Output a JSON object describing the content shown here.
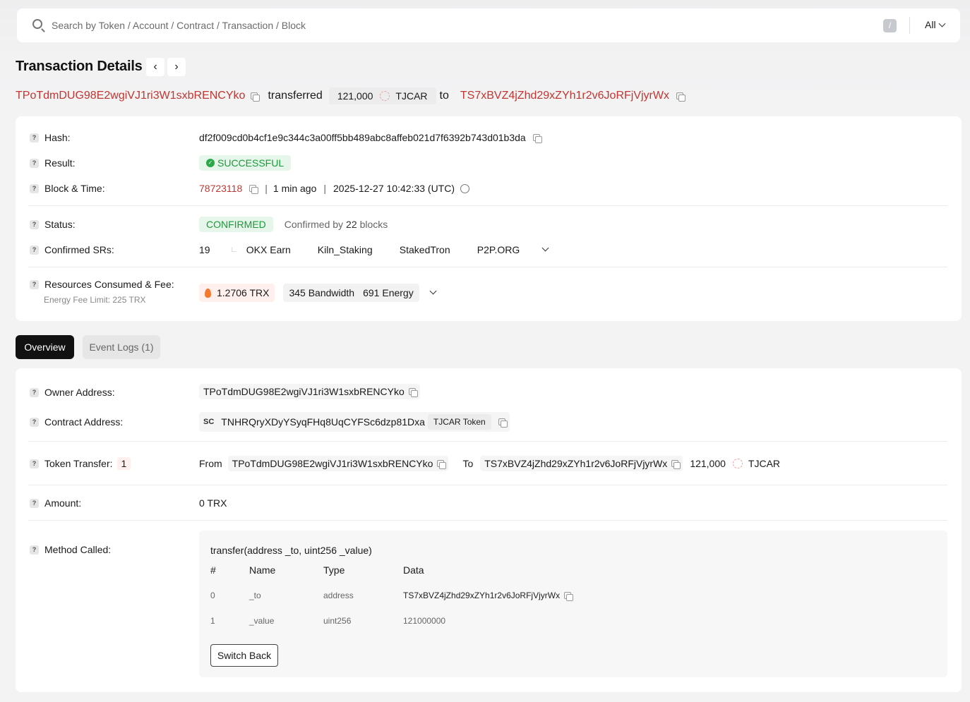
{
  "search": {
    "placeholder": "Search by Token / Account / Contract / Transaction / Block",
    "shortcut": "/",
    "filter": "All"
  },
  "page": {
    "title": "Transaction Details",
    "prev": "‹",
    "next": "›"
  },
  "summary": {
    "from": "TPoTdmDUG98E2wgiVJ1ri3W1sxbRENCYko",
    "verb": "transferred",
    "amount": "121,000",
    "token": "TJCAR",
    "to_word": "to",
    "to": "TS7xBVZ4jZhd29xZYh1r2v6JoRFjVjyrWx"
  },
  "details": {
    "hash_label": "Hash:",
    "hash": "df2f009cd0b4cf1e9c344c3a00ff5bb489abc8affeb021d7f6392b743d01b3da",
    "result_label": "Result:",
    "result": "SUCCESSFUL",
    "block_label": "Block & Time:",
    "block": "78723118",
    "ago": "1 min ago",
    "time": "2025-12-27 10:42:33 (UTC)",
    "status_label": "Status:",
    "status": "CONFIRMED",
    "confirmed_prefix": "Confirmed by",
    "confirmed_count": "22",
    "confirmed_suffix": "blocks",
    "srs_label": "Confirmed SRs:",
    "srs_count": "19",
    "srs": [
      "OKX Earn",
      "Kiln_Staking",
      "StakedTron",
      "P2P.ORG"
    ],
    "resources_label": "Resources Consumed & Fee:",
    "fee_limit": "Energy Fee Limit: 225 TRX",
    "fee": "1.2706 TRX",
    "bandwidth": "345 Bandwidth",
    "energy": "691 Energy"
  },
  "tabs": {
    "overview": "Overview",
    "events": "Event Logs (1)"
  },
  "overview": {
    "owner_label": "Owner Address:",
    "owner": "TPoTdmDUG98E2wgiVJ1ri3W1sxbRENCYko",
    "contract_label": "Contract Address:",
    "sc": "SC",
    "contract": "TNHRQryXDyYSyqFHq8UqCYFSc6dzp81Dxa",
    "contract_tag": "TJCAR Token",
    "transfer_label": "Token Transfer:",
    "transfer_count": "1",
    "from_word": "From",
    "from": "TPoTdmDUG98E2wgiVJ1ri3W1sxbRENCYko",
    "to_word": "To",
    "to": "TS7xBVZ4jZhd29xZYh1r2v6JoRFjVjyrWx",
    "transfer_amount": "121,000",
    "transfer_token": "TJCAR",
    "amount_label": "Amount:",
    "amount": "0 TRX",
    "method_label": "Method Called:",
    "method_sig": "transfer(address _to, uint256 _value)",
    "cols": [
      "#",
      "Name",
      "Type",
      "Data"
    ],
    "rows": [
      {
        "i": "0",
        "name": "_to",
        "type": "address",
        "data": "TS7xBVZ4jZhd29xZYh1r2v6JoRFjVjyrWx"
      },
      {
        "i": "1",
        "name": "_value",
        "type": "uint256",
        "data": "121000000"
      }
    ],
    "switch_back": "Switch Back"
  }
}
